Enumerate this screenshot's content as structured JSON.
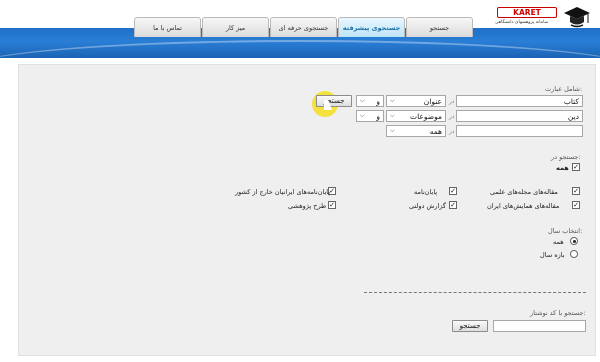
{
  "header": {
    "logo_text": "KARET",
    "logo_sub": "سامانه پژوهشهای دانشگاهی",
    "tabs": [
      {
        "label": "تماس با ما"
      },
      {
        "label": "میز کار"
      },
      {
        "label": "جستجوی حرفه ای"
      },
      {
        "label": "جستجوی پیشرفته"
      },
      {
        "label": "جستجو"
      }
    ],
    "active_tab": "جستجوی پیشرفته"
  },
  "search": {
    "phrase_label": "شامل عبارت:",
    "row1": {
      "value": "کتاب",
      "field": "عنوان",
      "op": "و",
      "in_label": "در"
    },
    "row2": {
      "value": "دین",
      "field": "موضوعات",
      "op": "و",
      "in_label": "در"
    },
    "row3": {
      "value": "",
      "field": "همه",
      "in_label": "در"
    },
    "search_button": "جستجو"
  },
  "search_in": {
    "label": "جستجو در:",
    "all": "همه",
    "options": [
      {
        "label": "مقاله‌های مجله‌های علمی",
        "checked": true
      },
      {
        "label": "پایان‌نامه",
        "checked": true
      },
      {
        "label": "پایان‌نامه‌های ایرانیان خارج از کشور",
        "checked": true
      },
      {
        "label": "مقاله‌های همایش‌های ایران",
        "checked": true
      },
      {
        "label": "گزارش دولتی",
        "checked": true
      },
      {
        "label": "طرح پژوهشی",
        "checked": true
      }
    ]
  },
  "year": {
    "label": "انتخاب سال:",
    "options": [
      {
        "label": "همه",
        "selected": true
      },
      {
        "label": "بازه سال",
        "selected": false
      }
    ]
  },
  "author_code": {
    "label": "جستجو با کد نوشتار:",
    "value": "",
    "button": "جستجو"
  }
}
